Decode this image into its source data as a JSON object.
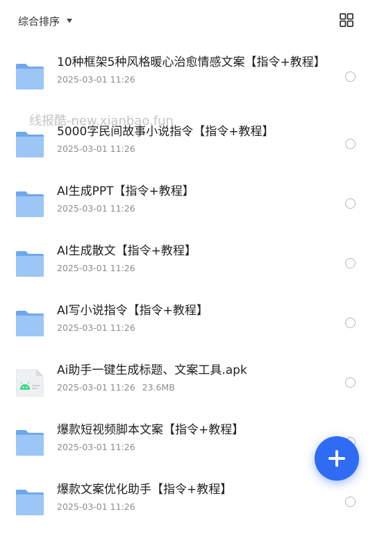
{
  "toolbar": {
    "sort_label": "综合排序",
    "view_toggle_icon": "grid-view-icon"
  },
  "watermark": "线报酷-new.xianbao.fun",
  "files": [
    {
      "name": "10种框架5种风格暖心治愈情感文案【指令+教程】",
      "date": "2025-03-01 11:26",
      "size": "",
      "type": "folder"
    },
    {
      "name": "5000字民间故事小说指令【指令+教程】",
      "date": "2025-03-01 11:26",
      "size": "",
      "type": "folder"
    },
    {
      "name": "AI生成PPT【指令+教程】",
      "date": "2025-03-01 11:26",
      "size": "",
      "type": "folder"
    },
    {
      "name": "AI生成散文【指令+教程】",
      "date": "2025-03-01 11:26",
      "size": "",
      "type": "folder"
    },
    {
      "name": "AI写小说指令【指令+教程】",
      "date": "2025-03-01 11:26",
      "size": "",
      "type": "folder"
    },
    {
      "name": "Ai助手一键生成标题、文案工具.apk",
      "date": "2025-03-01 11:26",
      "size": "23.6MB",
      "type": "apk"
    },
    {
      "name": "爆款短视频脚本文案【指令+教程】",
      "date": "2025-03-01 11:26",
      "size": "",
      "type": "folder"
    },
    {
      "name": "爆款文案优化助手【指令+教程】",
      "date": "2025-03-01 11:26",
      "size": "",
      "type": "folder"
    }
  ],
  "fab": {
    "icon": "plus-icon"
  },
  "colors": {
    "accent": "#2f6cf3",
    "folder": "#7fb3f0"
  }
}
